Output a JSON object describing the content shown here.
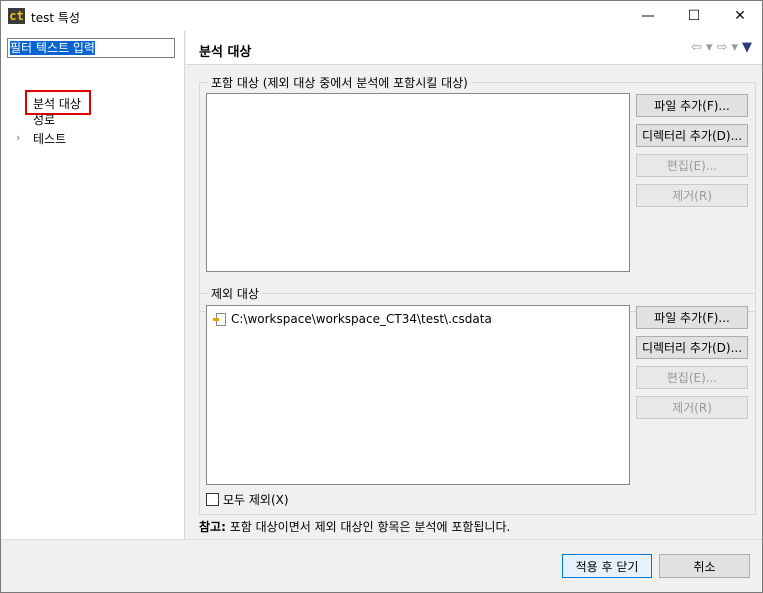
{
  "window": {
    "app_icon": "ct",
    "title": "test 특성",
    "minimize": "—",
    "maximize": "☐",
    "close": "✕"
  },
  "sidebar": {
    "filter_text": "필터 텍스트 입력",
    "items": [
      {
        "label": "분석 대상"
      },
      {
        "label": "성로"
      },
      {
        "label": "테스트",
        "expand": "›"
      }
    ]
  },
  "header": {
    "title": "분석 대상",
    "icons": [
      "back-icon",
      "dropdown-icon",
      "forward-icon",
      "dropdown-icon",
      "menu-icon"
    ]
  },
  "include": {
    "label": "포함 대상 (제외 대상 중에서 분석에 포함시킬 대상)",
    "buttons": {
      "add_file": "파일 추가(F)...",
      "add_dir": "디렉터리 추가(D)...",
      "edit": "편집(E)...",
      "remove": "제거(R)"
    }
  },
  "exclude": {
    "label": "제외 대상",
    "items": [
      "C:\\workspace\\workspace_CT34\\test\\.csdata"
    ],
    "buttons": {
      "add_file": "파일 추가(F)...",
      "add_dir": "디렉터리 추가(D)...",
      "edit": "편집(E)...",
      "remove": "제거(R)"
    },
    "exclude_all": "모두 제외(X)"
  },
  "note": {
    "prefix": "참고:",
    "text": " 포함 대상이면서 제외 대상인 항목은 분석에 포함됩니다."
  },
  "footer": {
    "apply_close": "적용 후 닫기",
    "cancel": "취소"
  }
}
